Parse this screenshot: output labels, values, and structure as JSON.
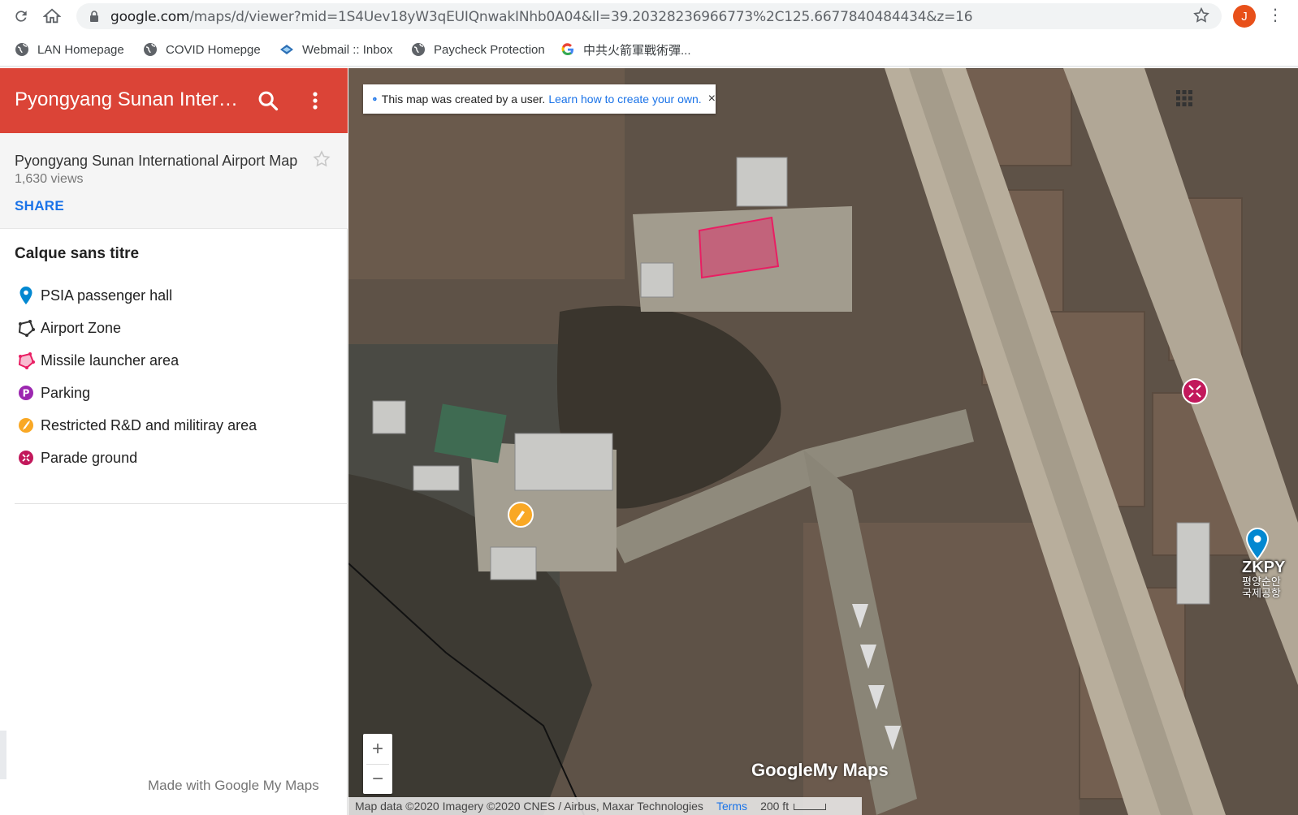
{
  "browser": {
    "url_host": "google.com",
    "url_path": "/maps/d/viewer?mid=1S4Uev18yW3qEUIQnwakINhb0A04&ll=39.20328236966773%2C125.6677840484434&z=16",
    "avatar_letter": "J"
  },
  "bookmarks": [
    {
      "label": "LAN Homepage",
      "icon": "globe-icon"
    },
    {
      "label": "COVID Homepge",
      "icon": "globe-icon"
    },
    {
      "label": "Webmail :: Inbox",
      "icon": "webmail-icon"
    },
    {
      "label": "Paycheck Protection",
      "icon": "globe-icon"
    },
    {
      "label": "中共火箭軍戰術彈...",
      "icon": "google-g-icon"
    }
  ],
  "panel": {
    "title": "Pyongyang Sunan International Airport Map",
    "map_name": "Pyongyang Sunan International Airport Map",
    "views": "1,630 views",
    "share_label": "SHARE",
    "layer_title": "Calque sans titre",
    "legend": [
      {
        "label": "PSIA passenger hall",
        "icon": "blue-pin-icon",
        "color": "#0288d1"
      },
      {
        "label": "Airport Zone",
        "icon": "polygon-outline-icon",
        "color": "#333333"
      },
      {
        "label": "Missile launcher area",
        "icon": "pink-polygon-icon",
        "color": "#e91e63"
      },
      {
        "label": "Parking",
        "icon": "parking-icon",
        "color": "#9c27b0"
      },
      {
        "label": "Restricted R&D and militiray area",
        "icon": "rocket-icon",
        "color": "#f9a825"
      },
      {
        "label": "Parade ground",
        "icon": "parade-icon",
        "color": "#c2185b"
      }
    ],
    "made_with": "Made with Google My Maps"
  },
  "map": {
    "notice_text": "This map was created by a user.",
    "notice_link": "Learn how to create your own.",
    "notice_close": "×",
    "zoom_in": "+",
    "zoom_out": "−",
    "attribution": "Map data ©2020 Imagery ©2020 CNES / Airbus, Maxar Technologies",
    "terms": "Terms",
    "scale": "200 ft",
    "logo_google": "Google",
    "logo_mymaps": "My Maps",
    "zkp_label": "ZKPY",
    "zkp_sub1": "평양순안",
    "zkp_sub2": "국제공항"
  },
  "colors": {
    "header_red": "#db4437",
    "link_blue": "#1a73e8"
  }
}
